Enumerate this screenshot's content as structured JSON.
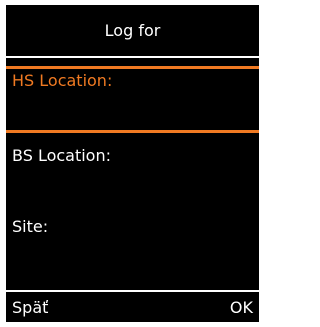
{
  "header": {
    "title": "Log for"
  },
  "menu": {
    "items": [
      {
        "label": "HS Location:",
        "selected": true
      },
      {
        "label": "BS Location:",
        "selected": false
      },
      {
        "label": "Site:",
        "selected": false
      }
    ]
  },
  "softkeys": {
    "left": "Späť",
    "right": "OK"
  },
  "colors": {
    "background": "#000000",
    "text": "#ffffff",
    "selection": "#f07a22"
  }
}
